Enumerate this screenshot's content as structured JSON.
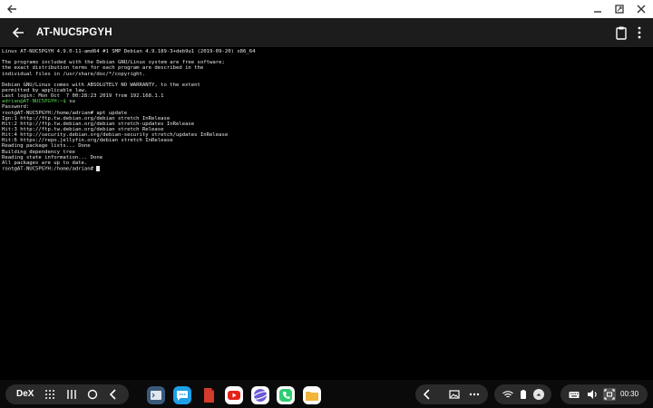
{
  "window": {
    "title": "AT-NUC5PGYH"
  },
  "icons": {
    "back": "arrow-left-icon",
    "minimize": "minimize-icon",
    "maximize": "maximize-icon",
    "close": "close-icon",
    "clipboard": "clipboard-icon",
    "more": "more-vert-icon"
  },
  "terminal": {
    "lines": [
      {
        "text": "Linux AT-NUC5PGYH 4.9.0-11-amd64 #1 SMP Debian 4.9.189-3+deb9u1 (2019-09-20) x86_64"
      },
      {
        "text": ""
      },
      {
        "text": "The programs included with the Debian GNU/Linux system are free software;"
      },
      {
        "text": "the exact distribution terms for each program are described in the"
      },
      {
        "text": "individual files in /usr/share/doc/*/copyright."
      },
      {
        "text": ""
      },
      {
        "text": "Debian GNU/Linux comes with ABSOLUTELY NO WARRANTY, to the extent"
      },
      {
        "text": "permitted by applicable law."
      },
      {
        "text": "Last login: Mon Oct  7 00:28:23 2019 from 192.168.1.1"
      },
      {
        "prompt": "adrian@AT-NUC5PGYH:~$",
        "text": " su"
      },
      {
        "text": "Password:"
      },
      {
        "text": "root@AT-NUC5PGYH:/home/adrian# apt update"
      },
      {
        "text": "Ign:1 http://ftp.tw.debian.org/debian stretch InRelease"
      },
      {
        "text": "Hit:2 http://ftp.tw.debian.org/debian stretch-updates InRelease"
      },
      {
        "text": "Hit:3 http://ftp.tw.debian.org/debian stretch Release"
      },
      {
        "text": "Hit:4 http://security.debian.org/debian-security stretch/updates InRelease"
      },
      {
        "text": "Hit:6 https://repo.jellyfin.org/debian stretch InRelease"
      },
      {
        "text": "Reading package lists... Done"
      },
      {
        "text": "Building dependency tree"
      },
      {
        "text": "Reading state information... Done"
      },
      {
        "text": "All packages are up to date."
      },
      {
        "text": "root@AT-NUC5PGYH:/home/adrian# ",
        "cursor": true
      }
    ],
    "prompt_color": "#5ad65a"
  },
  "taskbar": {
    "dex_label": "DeX",
    "clock": "00:30",
    "apps": [
      {
        "name": "terminal-app",
        "color": "#3a5a7a"
      },
      {
        "name": "messages-app",
        "color": "#1ea0e8"
      },
      {
        "name": "files-app",
        "color": "#d33b2c"
      },
      {
        "name": "youtube-app",
        "color": "#ffffff"
      },
      {
        "name": "internet-app",
        "color": "#6a5ad6"
      },
      {
        "name": "phone-app",
        "color": "#2ecc71"
      },
      {
        "name": "my-files-app",
        "color": "#f2b53a"
      }
    ]
  }
}
